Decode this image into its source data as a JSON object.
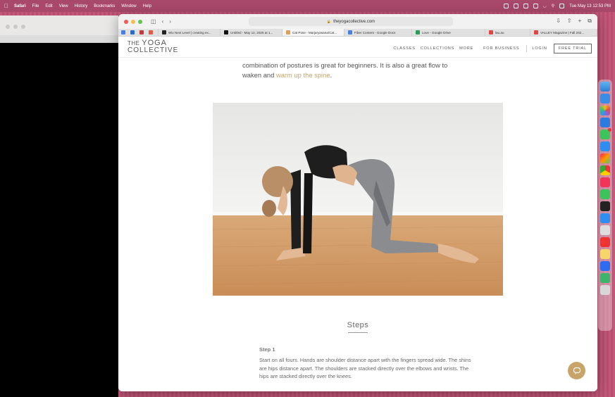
{
  "menubar": {
    "app": "Safari",
    "items": [
      "File",
      "Edit",
      "View",
      "History",
      "Bookmarks",
      "Window",
      "Help"
    ],
    "clock": "Tue May 13  12:53 PM"
  },
  "browser": {
    "url": "theyogacollective.com",
    "tabs": [
      {
        "label": "Wix Next Level | creating ex...",
        "color": "#222"
      },
      {
        "label": "Untitled - May 12, 2025 at 1...",
        "color": "#111"
      },
      {
        "label": "Cat Pose - Marjaryasana/Cat...",
        "color": "#d9a35b",
        "active": true
      },
      {
        "label": "Fiber Content - Google Docs",
        "color": "#4a7fe0"
      },
      {
        "label": "Love - Google Drive",
        "color": "#2a9d5b"
      },
      {
        "label": "lau.au",
        "color": "#e04646"
      },
      {
        "label": "VALLEY Magazine | Fall 202...",
        "color": "#e04646"
      }
    ]
  },
  "site": {
    "logo_line1": "THE",
    "logo_yoga": "YOGA",
    "logo_line2": "COLLECTIVE",
    "nav": {
      "classes": "CLASSES",
      "collections": "COLLECTIONS",
      "more": "MORE",
      "business": "FOR BUSINESS",
      "login": "LOGIN",
      "trial": "FREE TRIAL"
    }
  },
  "article": {
    "intro_text": "combination of postures is great for beginners. It is also a great flow to waken and ",
    "intro_link": "warm up the spine",
    "intro_end": ".",
    "steps_title": "Steps",
    "step1_title": "Step 1",
    "step1_text": "Start on all fours. Hands are shoulder distance apart with the fingers spread wide. The shins are hips distance apart.  The shoulders are stacked directly over the elbows and wrists. The hips are stacked directly over the knees."
  },
  "colors": {
    "accent": "#c9a46a",
    "wallpaper": "#c4587a"
  },
  "dock_apps": [
    "finder-icon",
    "mail-icon",
    "photos-icon",
    "chrome-icon",
    "facetime-icon",
    "app-store-icon",
    "launchpad-icon",
    "chrome-icon",
    "music-icon",
    "messages-icon",
    "threads-icon",
    "safari-icon",
    "phone-mirror-icon",
    "clock-icon",
    "notes-icon",
    "zoom-icon",
    "maps-icon",
    "trash-icon"
  ]
}
